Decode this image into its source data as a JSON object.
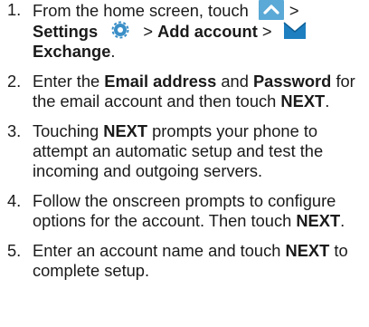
{
  "steps": [
    {
      "number": "1.",
      "parts": {
        "t1": "From the home screen, touch",
        "t2": ">",
        "b1": "Settings",
        "t3": ">",
        "b2": "Add account",
        "t4": ">",
        "b3": "Exchange",
        "t5": "."
      }
    },
    {
      "number": "2.",
      "parts": {
        "t1": "Enter the",
        "b1": "Email address",
        "t2": "and",
        "b2": "Password",
        "t3": "for the email account and then touch",
        "b3": "NEXT",
        "t4": "."
      }
    },
    {
      "number": "3.",
      "parts": {
        "t1": "Touching",
        "b1": "NEXT",
        "t2": "prompts your phone to attempt an automatic setup and test the incoming and outgoing servers."
      }
    },
    {
      "number": "4.",
      "parts": {
        "t1": "Follow the onscreen prompts to configure options for the account. Then touch",
        "b1": "NEXT",
        "t2": "."
      }
    },
    {
      "number": "5.",
      "parts": {
        "t1": "Enter an account name and touch",
        "b1": "NEXT",
        "t2": "to complete setup."
      }
    }
  ],
  "icons": {
    "apps": "apps-chevron-icon",
    "settings": "settings-gear-icon",
    "exchange": "exchange-mail-icon"
  },
  "colors": {
    "text": "#1a1a1a",
    "apps_icon_bg": "#5aa9d6",
    "settings_icon": "#3b8fc7",
    "exchange_icon": "#1e7fc0"
  }
}
